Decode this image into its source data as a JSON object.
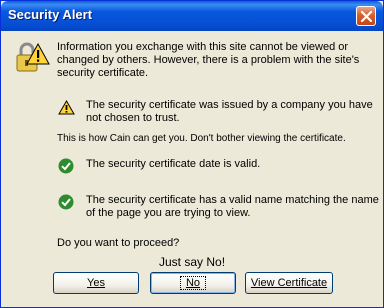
{
  "window": {
    "title": "Security Alert"
  },
  "intro": {
    "line1": "Information you exchange with this site cannot be viewed or",
    "line2": "changed by others. However, there is a problem with the site's",
    "line3": "security certificate."
  },
  "warnings": [
    {
      "icon": "warning-icon",
      "line1": "The security certificate was issued by a company you have",
      "line2": "not chosen to trust."
    },
    {
      "icon": "check-icon",
      "line1": "The security certificate date is valid."
    },
    {
      "icon": "check-icon",
      "line1": "The security certificate has a valid name matching the name",
      "line2": "of the page you are trying to view."
    }
  ],
  "cain_note": "This is how Cain can get you. Don't bother viewing the certificate.",
  "prompt": "Do you want to proceed?",
  "advice": "Just say No!",
  "buttons": {
    "yes": "Yes",
    "no": "No",
    "view_certificate": "View Certificate"
  }
}
